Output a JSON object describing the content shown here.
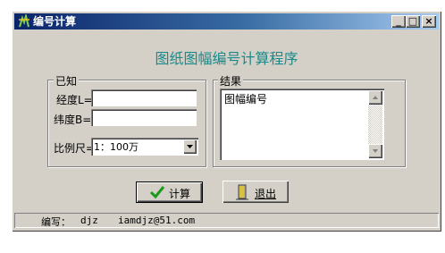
{
  "window": {
    "title": "编号计算",
    "controls": {
      "minimize": "_",
      "maximize": "□",
      "close": "×"
    }
  },
  "heading": "图纸图幅编号计算程序",
  "known_group": {
    "label": "已知",
    "longitude_label": "经度L=",
    "longitude_value": "",
    "latitude_label": "纬度B=",
    "latitude_value": "",
    "scale_label": "比例尺=",
    "scale_value": "1：100万"
  },
  "result_group": {
    "label": "结果",
    "text": "图幅编号"
  },
  "buttons": {
    "calculate": "计算",
    "exit": "退出"
  },
  "status": {
    "author_label": "编写：",
    "author": "djz",
    "email": "iamdjz@51.com"
  },
  "colors": {
    "heading": "#1a8a8a",
    "title_bar": "#0a246a",
    "check_icon": "#1a9a1a"
  }
}
